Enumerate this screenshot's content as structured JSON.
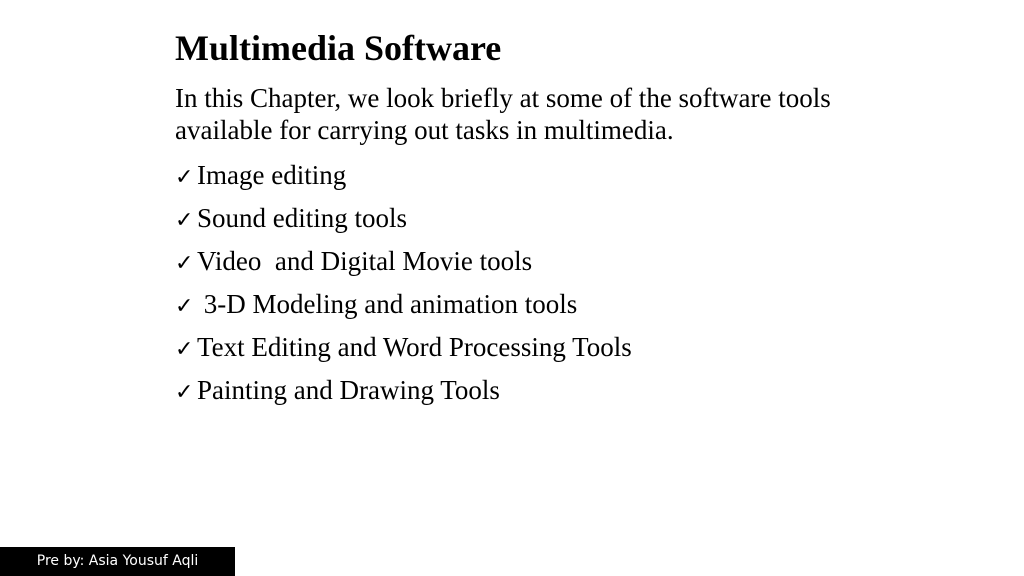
{
  "slide": {
    "title": "Multimedia Software",
    "intro": "In this Chapter, we look briefly at some of the software tools available for carrying out tasks in multimedia.",
    "bullet_icon": "check-icon",
    "bullet_glyph": "✓",
    "bullets": [
      {
        "label": "Image editing"
      },
      {
        "label": "Sound editing tools"
      },
      {
        "label": "Video  and Digital Movie tools"
      },
      {
        "label": " 3-D Modeling and animation tools"
      },
      {
        "label": "Text Editing and Word Processing Tools"
      },
      {
        "label": "Painting and Drawing Tools"
      }
    ]
  },
  "footer": {
    "text": "Pre by: Asia Yousuf Aqli",
    "background": "#000000",
    "color": "#ffffff"
  }
}
